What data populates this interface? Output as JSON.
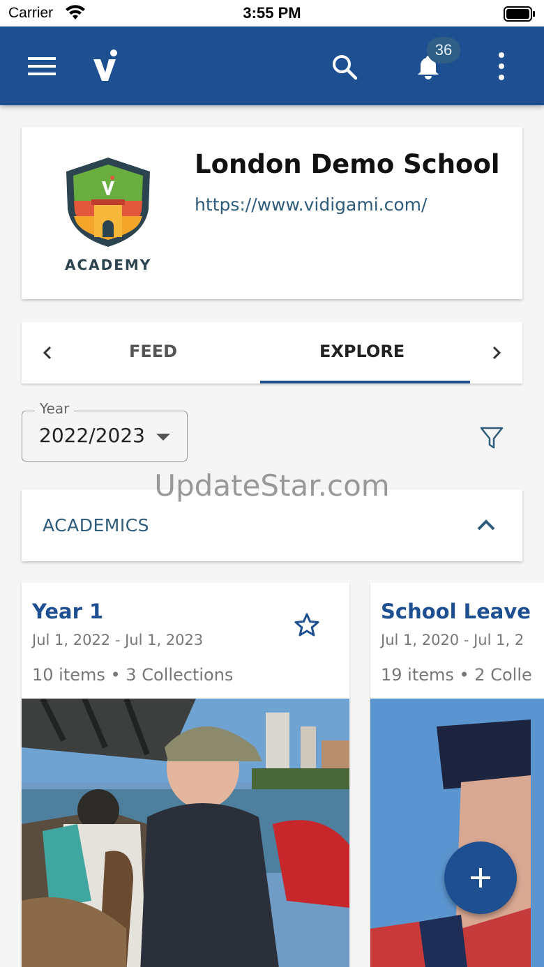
{
  "status_bar": {
    "carrier": "Carrier",
    "time": "3:55 PM"
  },
  "app_bar": {
    "notification_count": "36",
    "brand_color": "#1d4f91"
  },
  "school": {
    "name": "London Demo School",
    "url": "https://www.vidigami.com/",
    "logo_text": "ACADEMY"
  },
  "tabs": [
    {
      "label": "FEED",
      "selected": false
    },
    {
      "label": "EXPLORE",
      "selected": true
    }
  ],
  "filters": {
    "year_label": "Year",
    "year_value": "2022/2023"
  },
  "watermark": "UpdateStar.com",
  "section": {
    "label": "ACADEMICS",
    "expanded": true
  },
  "collections": [
    {
      "title": "Year 1",
      "dates": "Jul 1, 2022 - Jul 1, 2023",
      "meta": "10 items • 3 Collections"
    },
    {
      "title": "School Leave",
      "dates": "Jul 1, 2020 - Jul 1, 2",
      "meta": "19 items • 2 Colle"
    }
  ]
}
